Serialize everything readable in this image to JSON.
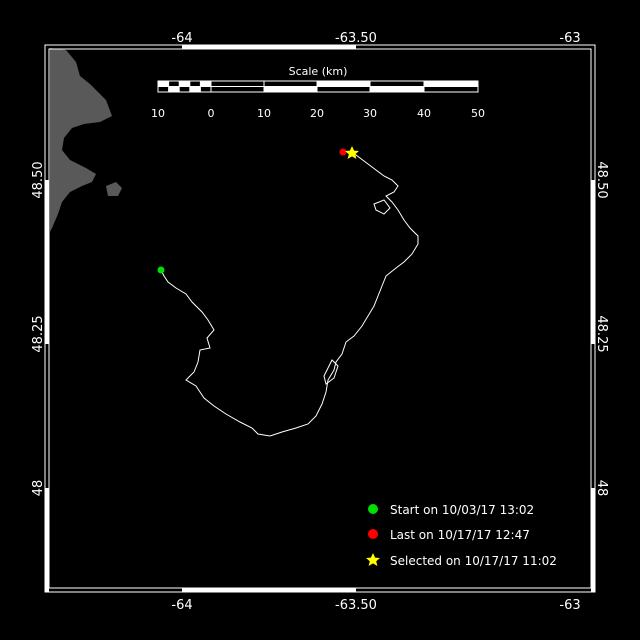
{
  "map": {
    "lon_labels": [
      "-64",
      "-63.50",
      "-63"
    ],
    "lat_labels": [
      "48.50",
      "48.25",
      "48"
    ],
    "colors": {
      "background": "#000000",
      "land": "#595959",
      "track": "#ffffff",
      "start": "#00e000",
      "last": "#ff0000",
      "selected": "#ffff00"
    }
  },
  "scale_bar": {
    "title": "Scale (km)",
    "ticks": [
      "10",
      "0",
      "10",
      "20",
      "30",
      "40",
      "50"
    ]
  },
  "legend": {
    "start": "Start on 10/03/17 13:02",
    "last": "Last on 10/17/17 12:47",
    "selected": "Selected on 10/17/17 11:02"
  }
}
